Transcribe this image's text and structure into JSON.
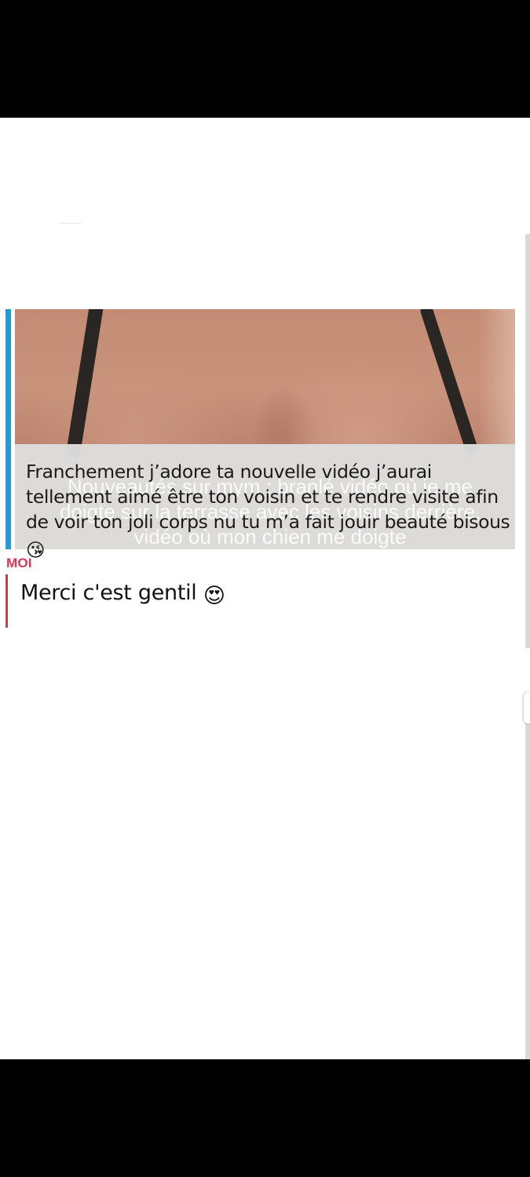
{
  "conversation": {
    "quoted_reply": {
      "media_caption": "Nouveautés sur mym : branlé vidéo où je me doigte sur la terrasse avec les voisins derrière, vidéo où mon chien me doigte",
      "text": "Franchement j’adore ta nouvelle vidéo j’aurai tellement aimé être ton voisin et te rendre visite afin de voir ton joli corps nu tu m’a fait jouir beauté bisous",
      "emoji": "😘",
      "accent_color": "#1a9ee0"
    },
    "my_message": {
      "sender": "MOI",
      "text": "Merci c'est gentil",
      "emoji": "😍",
      "accent_color": "#d3364f"
    }
  }
}
